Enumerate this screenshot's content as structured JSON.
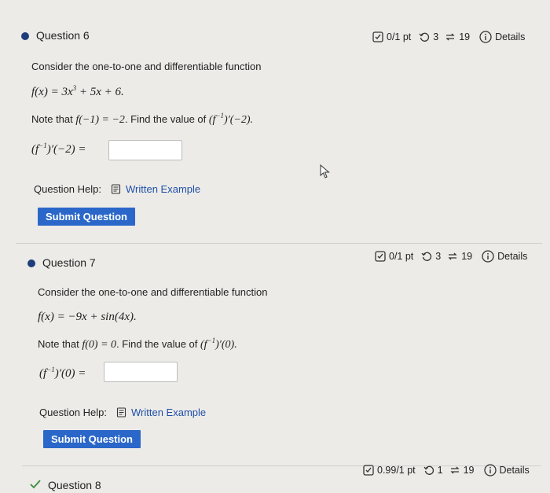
{
  "q6": {
    "title": "Question 6",
    "points": "0/1 pt",
    "retries": "3",
    "attempts": "19",
    "details": "Details",
    "intro": "Consider the one-to-one and differentiable function",
    "func_lhs": "f(x) = 3x",
    "func_exp": "3",
    "func_rhs": " + 5x + 6.",
    "note_prefix": "Note that ",
    "note_given": "f(−1) = −2",
    "note_mid": ". Find the value of ",
    "note_target": "(f",
    "note_target_exp": "−1",
    "note_target_end": ")′(−2).",
    "answer_label_pre": "(f",
    "answer_label_exp": "−1",
    "answer_label_post": ")′(−2) =",
    "help_label": "Question Help:",
    "help_link": "Written Example",
    "submit": "Submit Question"
  },
  "q7": {
    "title": "Question 7",
    "points": "0/1 pt",
    "retries": "3",
    "attempts": "19",
    "details": "Details",
    "intro": "Consider the one-to-one and differentiable function",
    "func": "f(x) = −9x + sin(4x).",
    "note_prefix": "Note that ",
    "note_given": "f(0) = 0",
    "note_mid": ". Find the value of ",
    "note_target": "(f",
    "note_target_exp": "−1",
    "note_target_end": ")′(0).",
    "answer_label_pre": "(f",
    "answer_label_exp": "−1",
    "answer_label_post": ")′(0) =",
    "help_label": "Question Help:",
    "help_link": "Written Example",
    "submit": "Submit Question"
  },
  "q8": {
    "title": "Question 8",
    "points": "0.99/1 pt",
    "retries": "1",
    "attempts": "19",
    "details": "Details"
  }
}
